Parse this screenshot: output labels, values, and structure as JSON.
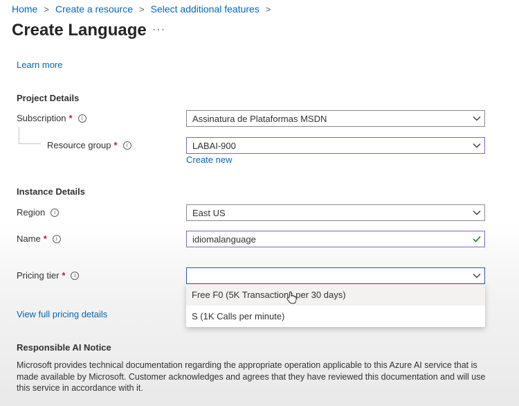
{
  "breadcrumb": [
    {
      "label": "Home"
    },
    {
      "label": "Create a resource"
    },
    {
      "label": "Select additional features"
    }
  ],
  "page": {
    "title": "Create Language",
    "more": "···"
  },
  "learn_more": "Learn more",
  "project": {
    "heading": "Project Details",
    "subscription": {
      "label": "Subscription",
      "required": "*",
      "value": "Assinatura de Plataformas MSDN"
    },
    "resource_group": {
      "label": "Resource group",
      "required": "*",
      "value": "LABAI-900",
      "create_new": "Create new"
    }
  },
  "instance": {
    "heading": "Instance Details",
    "region": {
      "label": "Region",
      "value": "East US"
    },
    "name": {
      "label": "Name",
      "required": "*",
      "value": "idiomalanguage"
    },
    "pricing": {
      "label": "Pricing tier",
      "required": "*",
      "value": "",
      "options": [
        "Free F0 (5K Transactions per 30 days)",
        "S (1K Calls per minute)"
      ]
    },
    "view_pricing": "View full pricing details"
  },
  "notice": {
    "heading": "Responsible AI Notice",
    "body": "Microsoft provides technical documentation regarding the appropriate operation applicable to this Azure AI service that is made available by Microsoft. Customer acknowledges and agrees that they have reviewed this documentation and will use this service in accordance with it."
  },
  "icons": {
    "info": "info-icon",
    "chevron": "chevron-down-icon",
    "check": "checkmark-icon",
    "cursor": "mouse-pointer-icon"
  },
  "colors": {
    "link": "#0067b8",
    "required": "#a4262c",
    "valid": "#107c10",
    "focus": "#2b579a"
  }
}
